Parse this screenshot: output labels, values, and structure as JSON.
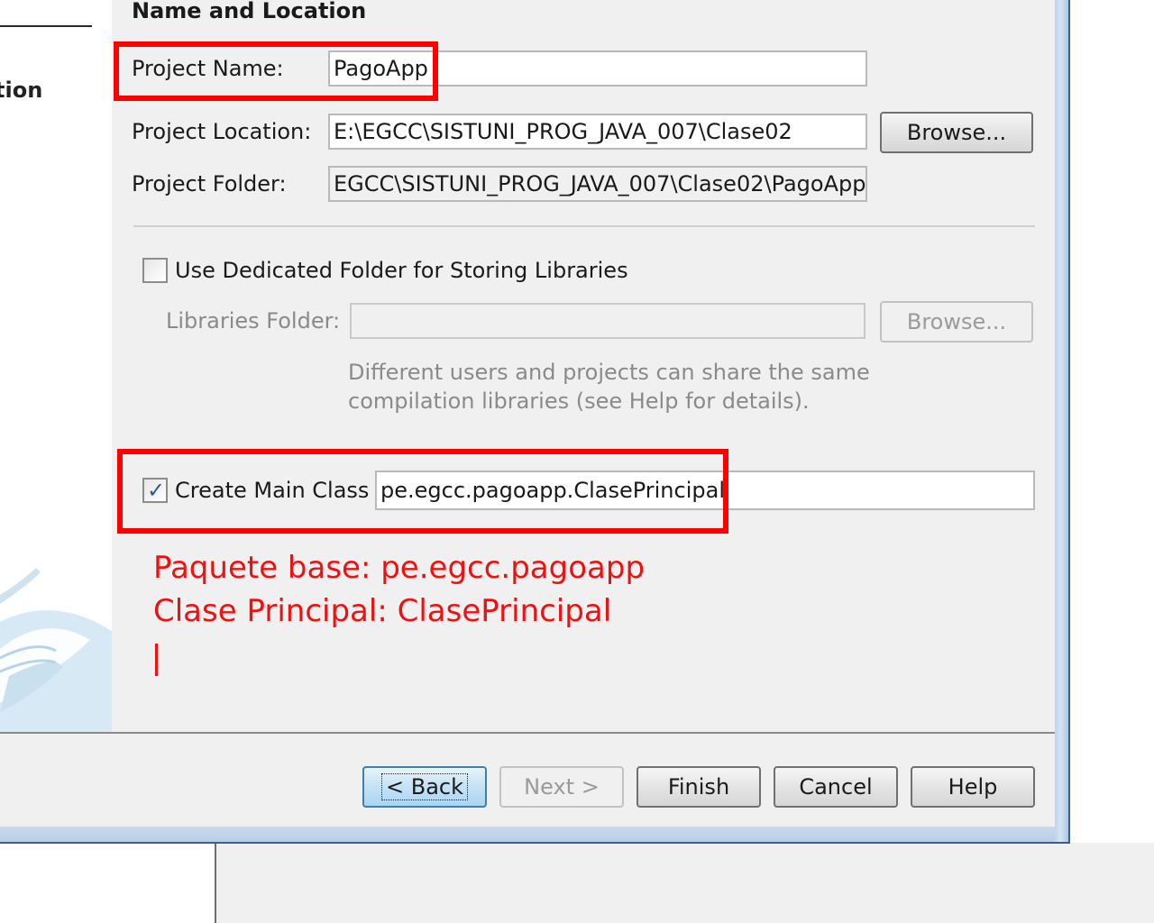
{
  "steps": {
    "current_item_fragment": "tion"
  },
  "section": {
    "title": "Name and Location"
  },
  "project": {
    "name_label": "Project Name:",
    "name_value": "PagoApp",
    "location_label": "Project Location:",
    "location_value": "E:\\EGCC\\SISTUNI_PROG_JAVA_007\\Clase02",
    "location_browse": "Browse...",
    "folder_label": "Project Folder:",
    "folder_value": "EGCC\\SISTUNI_PROG_JAVA_007\\Clase02\\PagoApp"
  },
  "libraries": {
    "checkbox_label": "Use Dedicated Folder for Storing Libraries",
    "checked": false,
    "folder_label": "Libraries Folder:",
    "folder_value": "",
    "browse": "Browse...",
    "hint_line1": "Different users and projects can share the same",
    "hint_line2": "compilation libraries (see Help for details)."
  },
  "main_class": {
    "checkbox_label": "Create Main Class",
    "checked": true,
    "value": "pe.egcc.pagoapp.ClasePrincipal"
  },
  "annotation": {
    "line1": "Paquete base: pe.egcc.pagoapp",
    "line2": "Clase Principal: ClasePrincipal",
    "color": "#ee1111"
  },
  "footer": {
    "back": "< Back",
    "next": "Next >",
    "finish": "Finish",
    "cancel": "Cancel",
    "help": "Help"
  }
}
